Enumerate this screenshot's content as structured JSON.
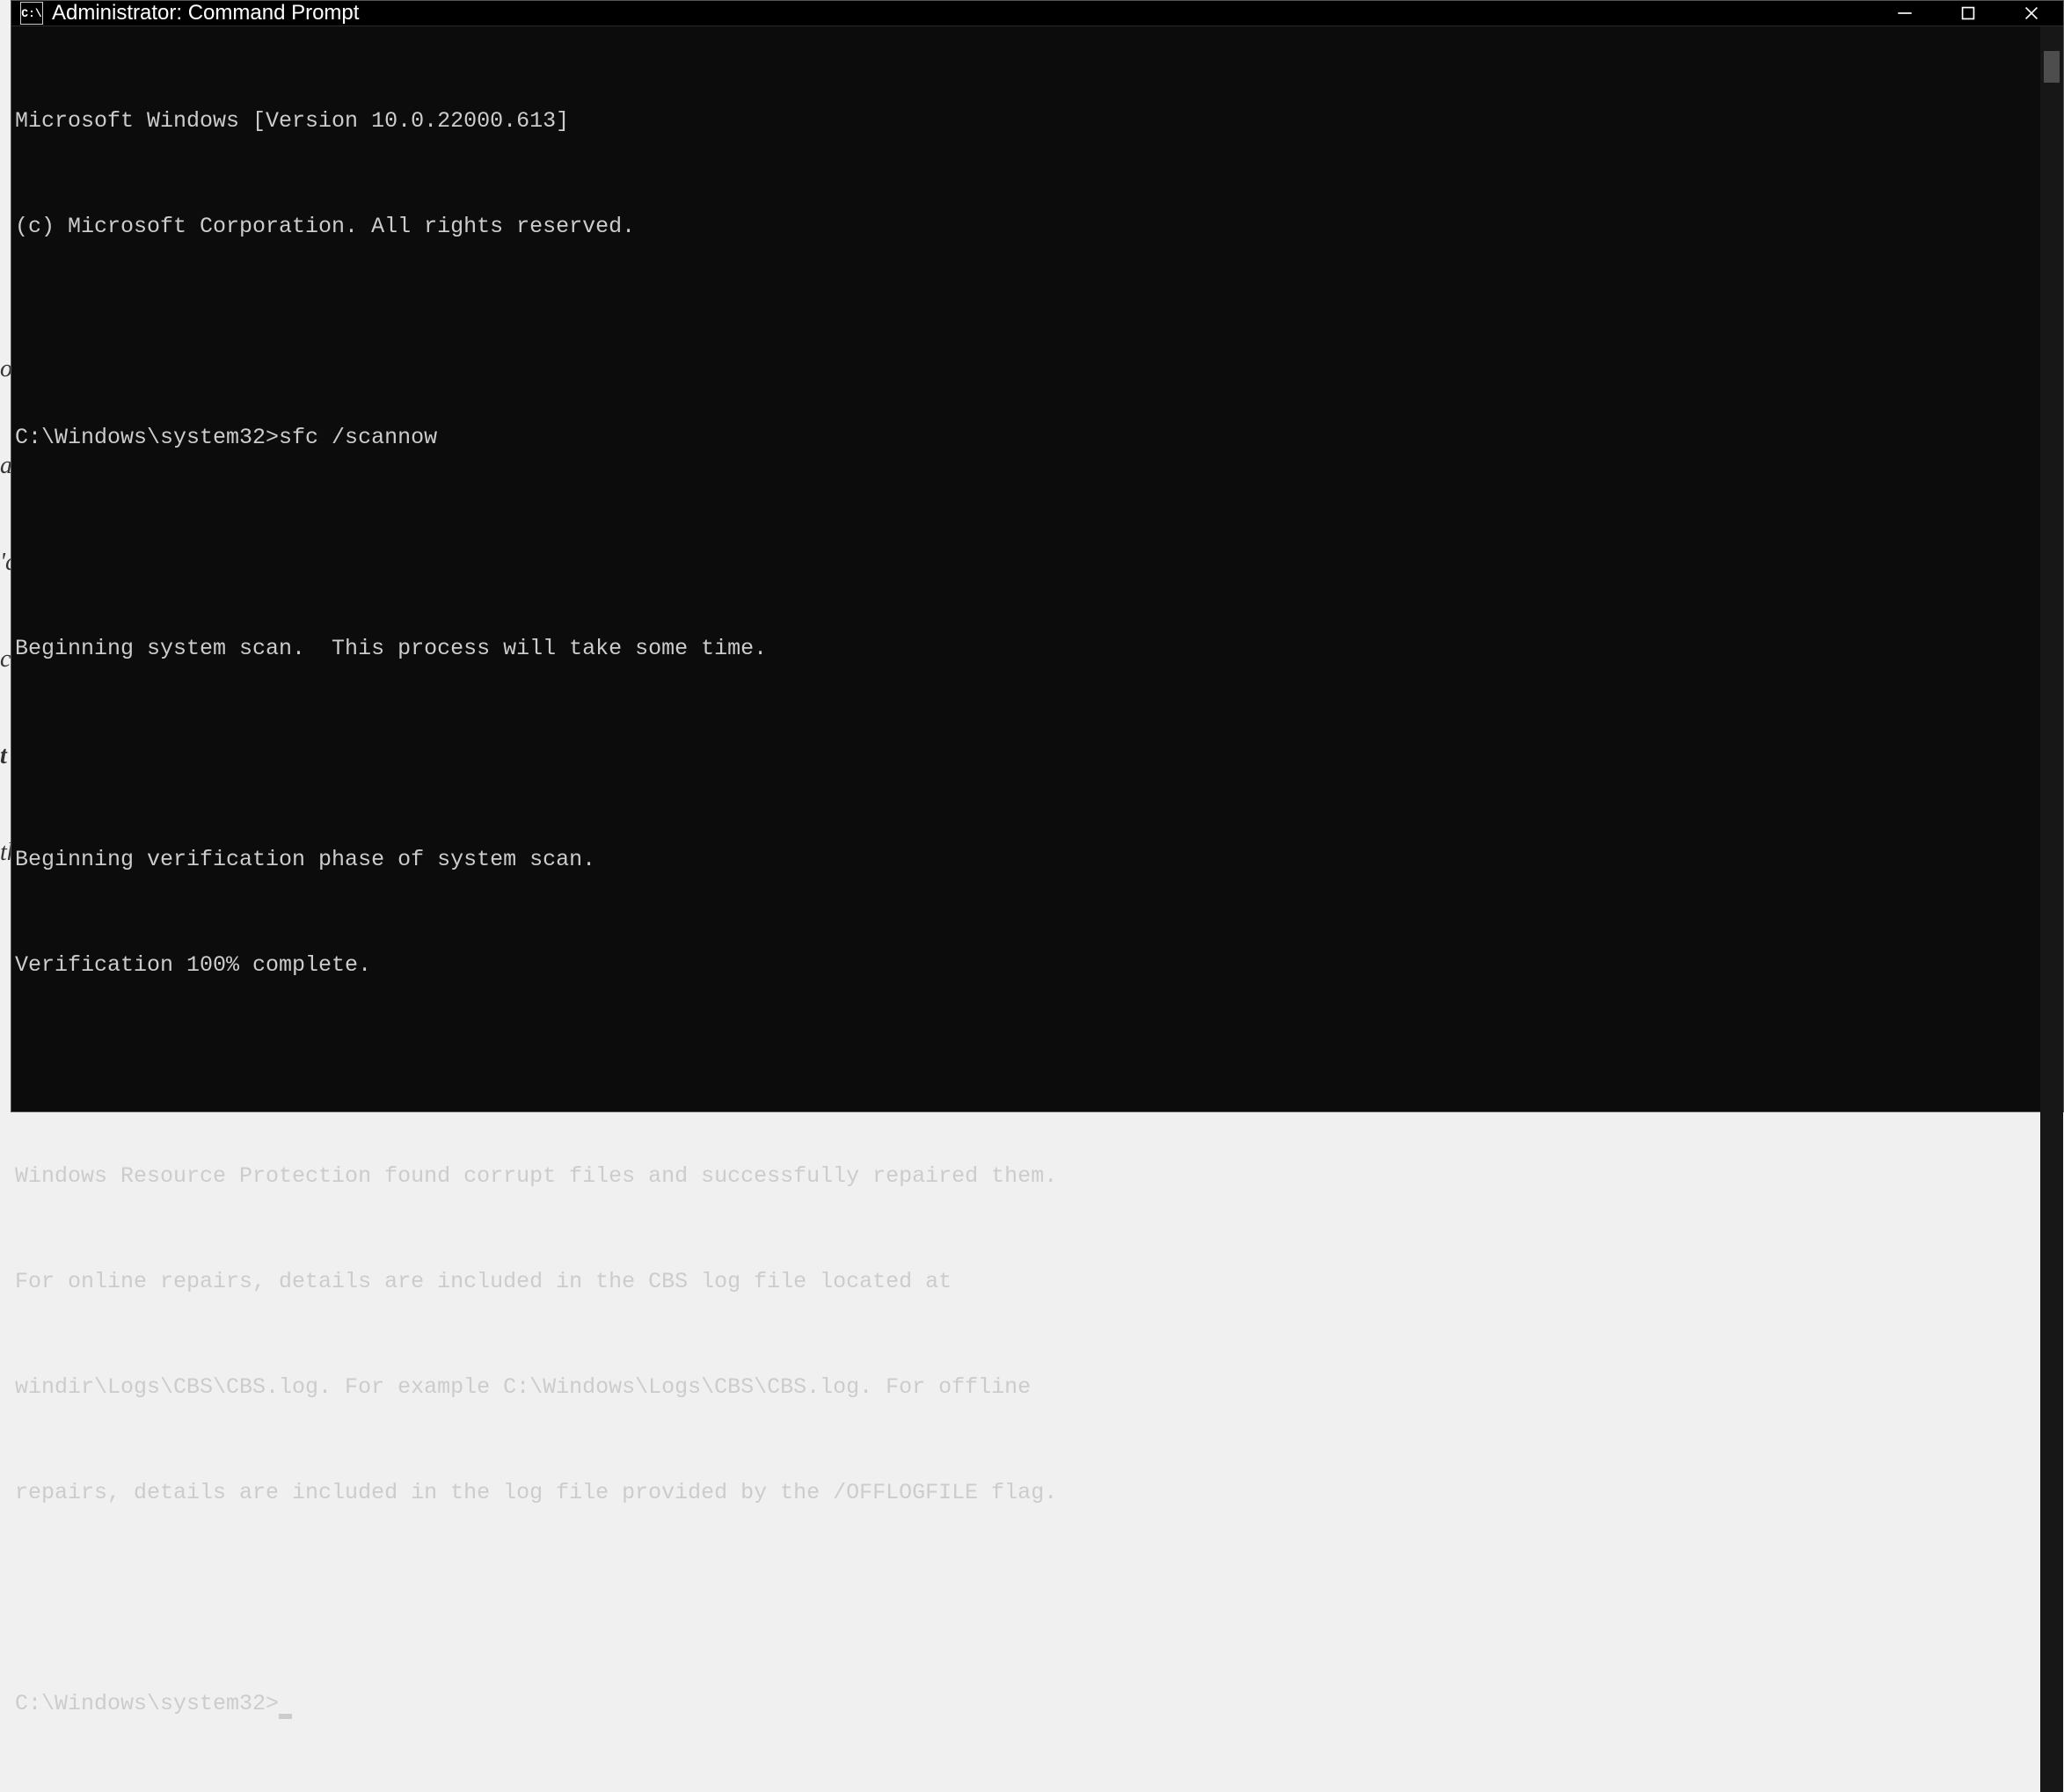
{
  "window": {
    "title": "Administrator: Command Prompt"
  },
  "terminal": {
    "lines": [
      "Microsoft Windows [Version 10.0.22000.613]",
      "(c) Microsoft Corporation. All rights reserved.",
      "",
      "C:\\Windows\\system32>sfc /scannow",
      "",
      "Beginning system scan.  This process will take some time.",
      "",
      "Beginning verification phase of system scan.",
      "Verification 100% complete.",
      "",
      "Windows Resource Protection found corrupt files and successfully repaired them.",
      "For online repairs, details are included in the CBS log file located at",
      "windir\\Logs\\CBS\\CBS.log. For example C:\\Windows\\Logs\\CBS\\CBS.log. For offline",
      "repairs, details are included in the log file provided by the /OFFLOGFILE flag.",
      ""
    ],
    "prompt": "C:\\Windows\\system32>"
  },
  "bg": {
    "h1": "or",
    "h2": "a",
    "h3": "'c",
    "h4": "c",
    "h5": "t",
    "h6": "th"
  }
}
